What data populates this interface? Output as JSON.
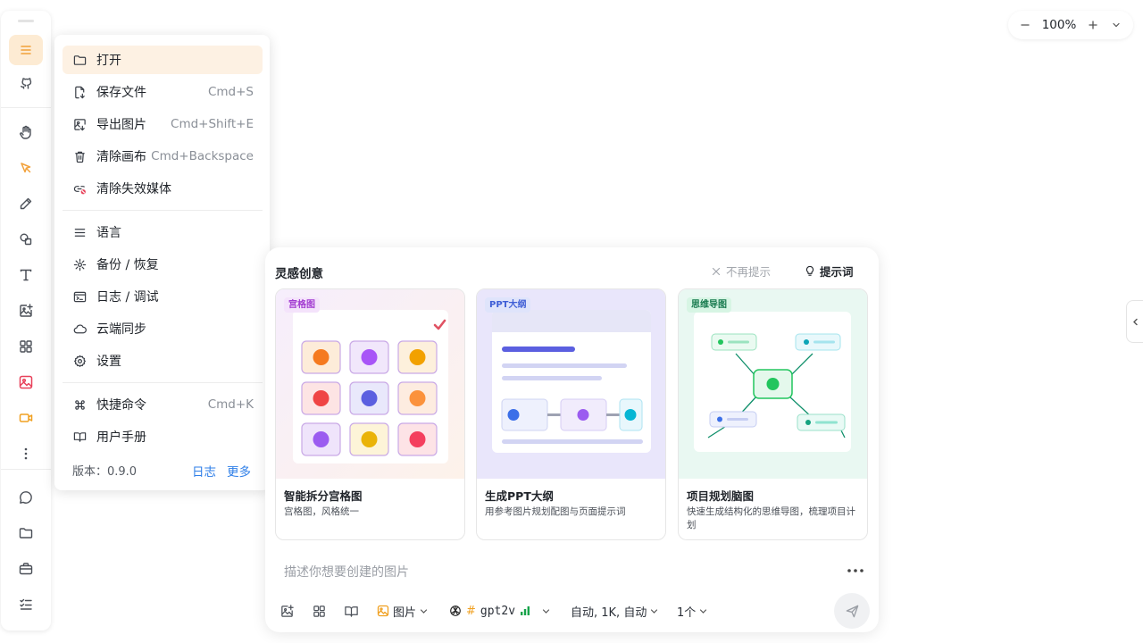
{
  "menu": {
    "items": [
      {
        "label": "打开",
        "shortcut": ""
      },
      {
        "label": "保存文件",
        "shortcut": "Cmd+S"
      },
      {
        "label": "导出图片",
        "shortcut": "Cmd+Shift+E"
      },
      {
        "label": "清除画布",
        "shortcut": "Cmd+Backspace"
      },
      {
        "label": "清除失效媒体",
        "shortcut": ""
      },
      {
        "label": "语言",
        "shortcut": ""
      },
      {
        "label": "备份 / 恢复",
        "shortcut": ""
      },
      {
        "label": "日志 / 调试",
        "shortcut": ""
      },
      {
        "label": "云端同步",
        "shortcut": ""
      },
      {
        "label": "设置",
        "shortcut": ""
      },
      {
        "label": "快捷命令",
        "shortcut": "Cmd+K"
      },
      {
        "label": "用户手册",
        "shortcut": ""
      }
    ],
    "version": "版本：0.9.0",
    "log_link": "日志",
    "more_link": "更多"
  },
  "zoom": {
    "value": "100%"
  },
  "inspiration": {
    "title": "灵感创意",
    "dismiss": "不再提示",
    "prompts": "提示词",
    "cards": [
      {
        "tag": "宫格图",
        "title": "智能拆分宫格图",
        "desc": "宫格图，风格统一"
      },
      {
        "tag": "PPT大纲",
        "title": "生成PPT大纲",
        "desc": "用参考图片规划配图与页面提示词"
      },
      {
        "tag": "思维导图",
        "title": "项目规划脑图",
        "desc": "快速生成结构化的思维导图，梳理项目计划"
      }
    ],
    "input_placeholder": "描述你想要创建的图片",
    "type_label": "图片",
    "model_label": "gpt2v",
    "settings_label": "自动, 1K, 自动",
    "count_label": "1个"
  },
  "colors": {
    "accent": "#f2a13b",
    "link": "#2f7fe8"
  }
}
